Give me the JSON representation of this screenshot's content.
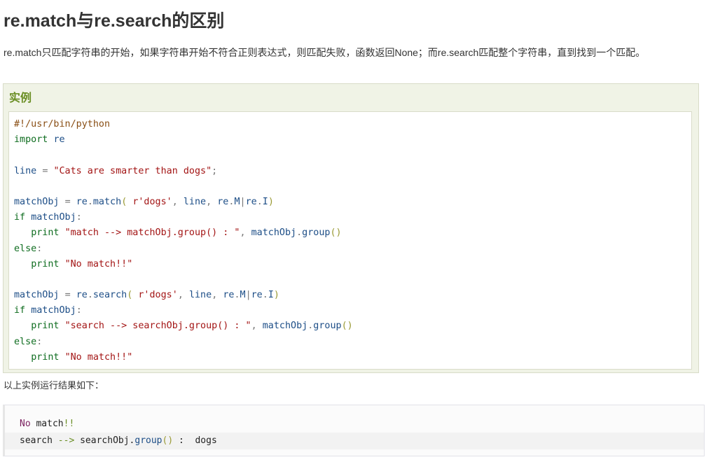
{
  "heading": "re.match与re.search的区别",
  "intro": "re.match只匹配字符串的开始，如果字符串开始不符合正则表达式，则匹配失败，函数返回None；而re.search匹配整个字符串，直到找到一个匹配。",
  "example": {
    "label": "实例",
    "code_lines": [
      [
        [
          "com",
          "#!/usr/bin/python"
        ]
      ],
      [
        [
          "kw",
          "import"
        ],
        [
          "pl",
          " "
        ],
        [
          "id",
          "re"
        ]
      ],
      [],
      [
        [
          "id",
          "line"
        ],
        [
          "pl",
          " "
        ],
        [
          "pu",
          "="
        ],
        [
          "pl",
          " "
        ],
        [
          "str",
          "\"Cats are smarter than dogs\""
        ],
        [
          "pu",
          ";"
        ]
      ],
      [],
      [
        [
          "id",
          "matchObj"
        ],
        [
          "pl",
          " "
        ],
        [
          "pu",
          "="
        ],
        [
          "pl",
          " "
        ],
        [
          "id",
          "re"
        ],
        [
          "pu",
          "."
        ],
        [
          "id",
          "match"
        ],
        [
          "par",
          "("
        ],
        [
          "pl",
          " "
        ],
        [
          "str",
          "r'dogs'"
        ],
        [
          "pu",
          ","
        ],
        [
          "pl",
          " "
        ],
        [
          "id",
          "line"
        ],
        [
          "pu",
          ","
        ],
        [
          "pl",
          " "
        ],
        [
          "id",
          "re"
        ],
        [
          "pu",
          "."
        ],
        [
          "id",
          "M"
        ],
        [
          "pu",
          "|"
        ],
        [
          "id",
          "re"
        ],
        [
          "pu",
          "."
        ],
        [
          "id",
          "I"
        ],
        [
          "par",
          ")"
        ]
      ],
      [
        [
          "kw",
          "if"
        ],
        [
          "pl",
          " "
        ],
        [
          "id",
          "matchObj"
        ],
        [
          "pu",
          ":"
        ]
      ],
      [
        [
          "pl",
          "   "
        ],
        [
          "kw",
          "print"
        ],
        [
          "pl",
          " "
        ],
        [
          "str",
          "\"match --> matchObj.group() : \""
        ],
        [
          "pu",
          ","
        ],
        [
          "pl",
          " "
        ],
        [
          "id",
          "matchObj"
        ],
        [
          "pu",
          "."
        ],
        [
          "id",
          "group"
        ],
        [
          "par",
          "()"
        ]
      ],
      [
        [
          "kw",
          "else"
        ],
        [
          "pu",
          ":"
        ]
      ],
      [
        [
          "pl",
          "   "
        ],
        [
          "kw",
          "print"
        ],
        [
          "pl",
          " "
        ],
        [
          "str",
          "\"No match!!\""
        ]
      ],
      [],
      [
        [
          "id",
          "matchObj"
        ],
        [
          "pl",
          " "
        ],
        [
          "pu",
          "="
        ],
        [
          "pl",
          " "
        ],
        [
          "id",
          "re"
        ],
        [
          "pu",
          "."
        ],
        [
          "id",
          "search"
        ],
        [
          "par",
          "("
        ],
        [
          "pl",
          " "
        ],
        [
          "str",
          "r'dogs'"
        ],
        [
          "pu",
          ","
        ],
        [
          "pl",
          " "
        ],
        [
          "id",
          "line"
        ],
        [
          "pu",
          ","
        ],
        [
          "pl",
          " "
        ],
        [
          "id",
          "re"
        ],
        [
          "pu",
          "."
        ],
        [
          "id",
          "M"
        ],
        [
          "pu",
          "|"
        ],
        [
          "id",
          "re"
        ],
        [
          "pu",
          "."
        ],
        [
          "id",
          "I"
        ],
        [
          "par",
          ")"
        ]
      ],
      [
        [
          "kw",
          "if"
        ],
        [
          "pl",
          " "
        ],
        [
          "id",
          "matchObj"
        ],
        [
          "pu",
          ":"
        ]
      ],
      [
        [
          "pl",
          "   "
        ],
        [
          "kw",
          "print"
        ],
        [
          "pl",
          " "
        ],
        [
          "str",
          "\"search --> searchObj.group() : \""
        ],
        [
          "pu",
          ","
        ],
        [
          "pl",
          " "
        ],
        [
          "id",
          "matchObj"
        ],
        [
          "pu",
          "."
        ],
        [
          "id",
          "group"
        ],
        [
          "par",
          "()"
        ]
      ],
      [
        [
          "kw",
          "else"
        ],
        [
          "pu",
          ":"
        ]
      ],
      [
        [
          "pl",
          "   "
        ],
        [
          "kw",
          "print"
        ],
        [
          "pl",
          " "
        ],
        [
          "str",
          "\"No match!!\""
        ]
      ]
    ]
  },
  "result_label": "以上实例运行结果如下：",
  "output_lines": [
    [
      [
        "kw",
        "No"
      ],
      [
        "pl",
        " match"
      ],
      [
        "op",
        "!!"
      ]
    ],
    [
      [
        "pl",
        "search "
      ],
      [
        "op",
        "-->"
      ],
      [
        "pl",
        " searchObj."
      ],
      [
        "id",
        "group"
      ],
      [
        "par",
        "()"
      ],
      [
        "pl",
        " :  dogs"
      ]
    ]
  ]
}
